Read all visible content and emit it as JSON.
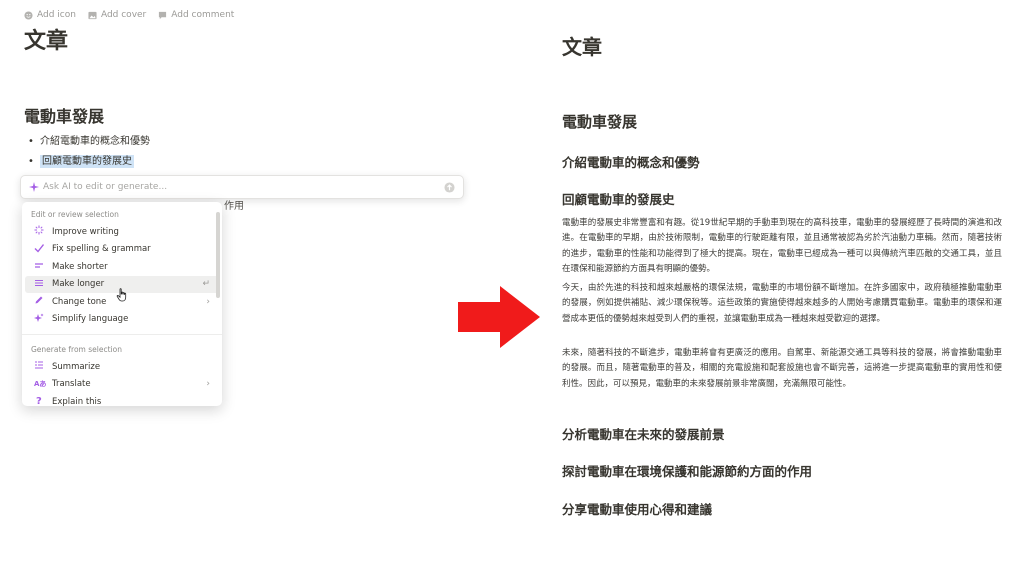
{
  "editor": {
    "top_actions": [
      "Add icon",
      "Add cover",
      "Add comment"
    ],
    "page_title": "文章",
    "heading": "電動車發展",
    "bullets": [
      "介紹電動車的概念和優勢",
      "回顧電動車的發展史"
    ],
    "partially_hidden_line": "作用"
  },
  "ai_bar": {
    "placeholder": "Ask AI to edit or generate..."
  },
  "ai_menu": {
    "section_edit": "Edit or review selection",
    "edit_items": [
      {
        "label": "Improve writing",
        "icon": "sparkle-icon"
      },
      {
        "label": "Fix spelling & grammar",
        "icon": "check-icon"
      },
      {
        "label": "Make shorter",
        "icon": "short-lines-icon"
      },
      {
        "label": "Make longer",
        "icon": "long-lines-icon",
        "right": "↵"
      },
      {
        "label": "Change tone",
        "icon": "pen-icon",
        "right": "›"
      },
      {
        "label": "Simplify language",
        "icon": "sparkle-icon"
      }
    ],
    "section_generate": "Generate from selection",
    "generate_items": [
      {
        "label": "Summarize",
        "icon": "summary-icon"
      },
      {
        "label": "Translate",
        "icon": "translate-icon",
        "right": "›"
      },
      {
        "label": "Explain this",
        "icon": "question-icon"
      }
    ]
  },
  "document": {
    "title": "文章",
    "heading": "電動車發展",
    "section1": "介紹電動車的概念和優勢",
    "section2": "回顧電動車的發展史",
    "paragraphs": [
      "電動車的發展史非常豐富和有趣。從19世紀早期的手動車到現在的高科技車，電動車的發展經歷了長時間的演進和改進。在電動車的早期，由於技術限制，電動車的行駛距離有限，並且通常被認為劣於汽油動力車輛。然而，隨著技術的進步，電動車的性能和功能得到了極大的提高。現在，電動車已經成為一種可以與傳統汽車匹敵的交通工具，並且在環保和能源節約方面具有明顯的優勢。",
      "今天，由於先進的科技和越來越嚴格的環保法規，電動車的市場份額不斷增加。在許多國家中，政府積極推動電動車的發展，例如提供補貼、減少環保稅等。這些政策的實施使得越來越多的人開始考慮購買電動車。電動車的環保和運營成本更低的優勢越來越受到人們的重視，並讓電動車成為一種越來越受歡迎的選擇。",
      "未來，隨著科技的不斷進步，電動車將會有更廣泛的應用。自駕車、新能源交通工具等科技的發展，將會推動電動車的發展。而且，隨著電動車的普及，相關的充電設施和配套設施也會不斷完善，這將進一步提高電動車的實用性和便利性。因此，可以預見，電動車的未來發展前景非常廣闊，充滿無限可能性。"
    ],
    "section3": "分析電動車在未來的發展前景",
    "section4": "探討電動車在環境保護和能源節約方面的作用",
    "section5": "分享電動車使用心得和建議"
  },
  "colors": {
    "selection": "#cfe3f6",
    "arrow": "#f01b1b",
    "ai_accent": "#a45ee5"
  }
}
